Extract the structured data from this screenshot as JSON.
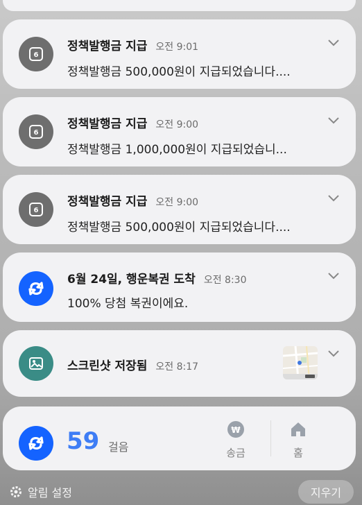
{
  "notifications": [
    {
      "title": "정책발행금 지급",
      "time": "오전 9:01",
      "body": "정책발행금 500,000원이 지급되었습니다....",
      "icon": "won-coin-icon"
    },
    {
      "title": "정책발행금 지급",
      "time": "오전 9:00",
      "body": "정책발행금 1,000,000원이 지급되었습니...",
      "icon": "won-coin-icon"
    },
    {
      "title": "정책발행금 지급",
      "time": "오전 9:00",
      "body": "정책발행금 500,000원이 지급되었습니다....",
      "icon": "won-coin-icon"
    },
    {
      "title": "6월 24일, 행운복권 도착",
      "time": "오전 8:30",
      "body": "100% 당첨 복권이에요.",
      "icon": "toss-logo-icon"
    },
    {
      "title": "스크린샷 저장됨",
      "time": "오전 8:17",
      "body": "",
      "icon": "image-icon"
    }
  ],
  "widget": {
    "steps": "59",
    "steps_unit": "걸음",
    "transfer_label": "송금",
    "home_label": "홈"
  },
  "footer": {
    "settings_label": "알림 설정",
    "clear_label": "지우기"
  },
  "colors": {
    "accent_blue": "#1463ff",
    "steps_blue": "#3e7df5",
    "gray_icon": "#6e6e6e",
    "teal_icon": "#3a8c86"
  }
}
